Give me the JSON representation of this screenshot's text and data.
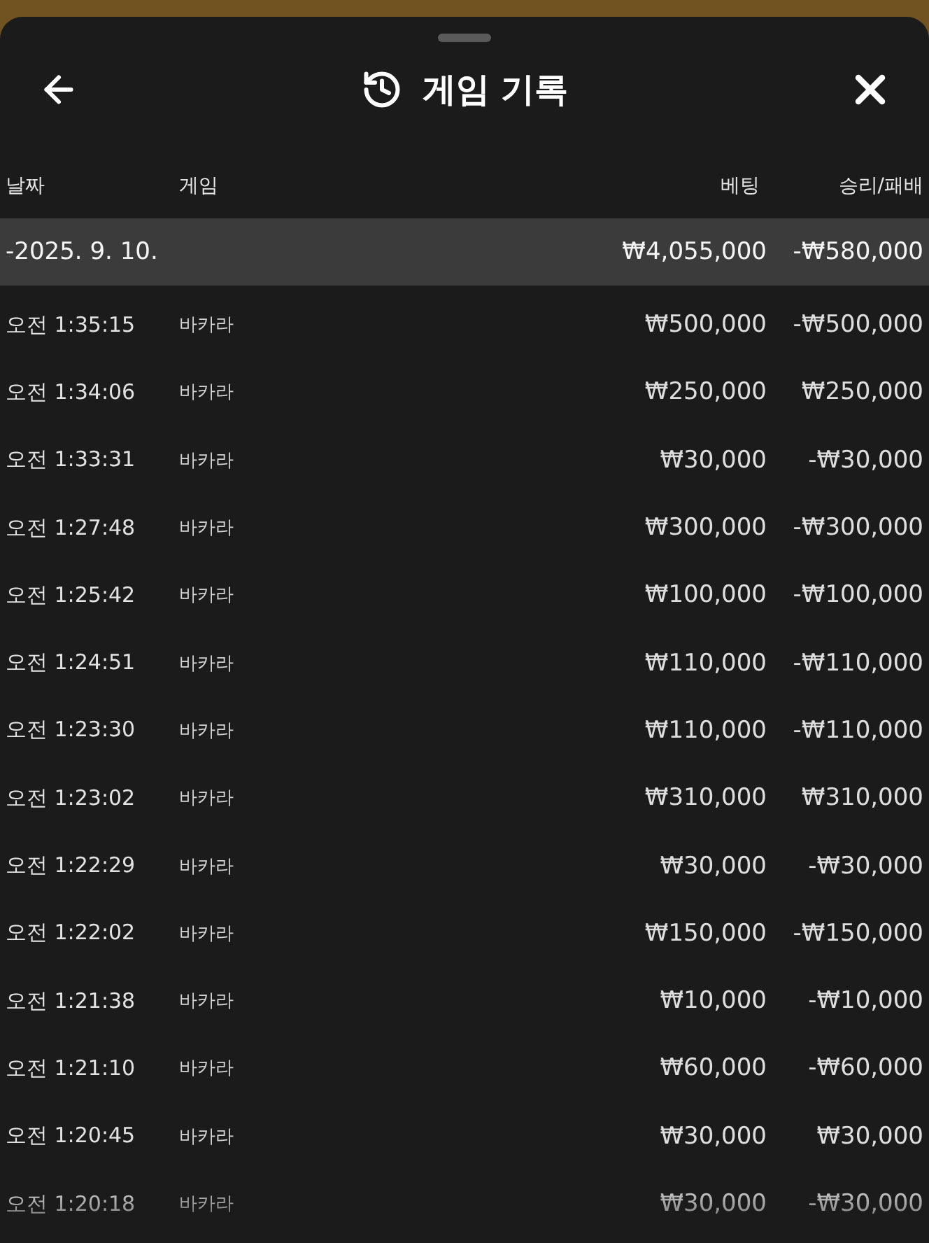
{
  "header": {
    "title": "게임 기록"
  },
  "table": {
    "columns": [
      "날짜",
      "게임",
      "베팅",
      "승리/패배"
    ],
    "groups": [
      {
        "date": "-2025. 9. 10.",
        "bet_total": "₩4,055,000",
        "result_total": "-₩580,000",
        "rows": [
          {
            "time": "오전 1:35:15",
            "game": "바카라",
            "bet": "₩500,000",
            "result": "-₩500,000"
          },
          {
            "time": "오전 1:34:06",
            "game": "바카라",
            "bet": "₩250,000",
            "result": "₩250,000"
          },
          {
            "time": "오전 1:33:31",
            "game": "바카라",
            "bet": "₩30,000",
            "result": "-₩30,000"
          },
          {
            "time": "오전 1:27:48",
            "game": "바카라",
            "bet": "₩300,000",
            "result": "-₩300,000"
          },
          {
            "time": "오전 1:25:42",
            "game": "바카라",
            "bet": "₩100,000",
            "result": "-₩100,000"
          },
          {
            "time": "오전 1:24:51",
            "game": "바카라",
            "bet": "₩110,000",
            "result": "-₩110,000"
          },
          {
            "time": "오전 1:23:30",
            "game": "바카라",
            "bet": "₩110,000",
            "result": "-₩110,000"
          },
          {
            "time": "오전 1:23:02",
            "game": "바카라",
            "bet": "₩310,000",
            "result": "₩310,000"
          },
          {
            "time": "오전 1:22:29",
            "game": "바카라",
            "bet": "₩30,000",
            "result": "-₩30,000"
          },
          {
            "time": "오전 1:22:02",
            "game": "바카라",
            "bet": "₩150,000",
            "result": "-₩150,000"
          },
          {
            "time": "오전 1:21:38",
            "game": "바카라",
            "bet": "₩10,000",
            "result": "-₩10,000"
          },
          {
            "time": "오전 1:21:10",
            "game": "바카라",
            "bet": "₩60,000",
            "result": "-₩60,000"
          },
          {
            "time": "오전 1:20:45",
            "game": "바카라",
            "bet": "₩30,000",
            "result": "₩30,000"
          },
          {
            "time": "오전 1:20:18",
            "game": "바카라",
            "bet": "₩30,000",
            "result": "-₩30,000"
          }
        ]
      }
    ]
  }
}
